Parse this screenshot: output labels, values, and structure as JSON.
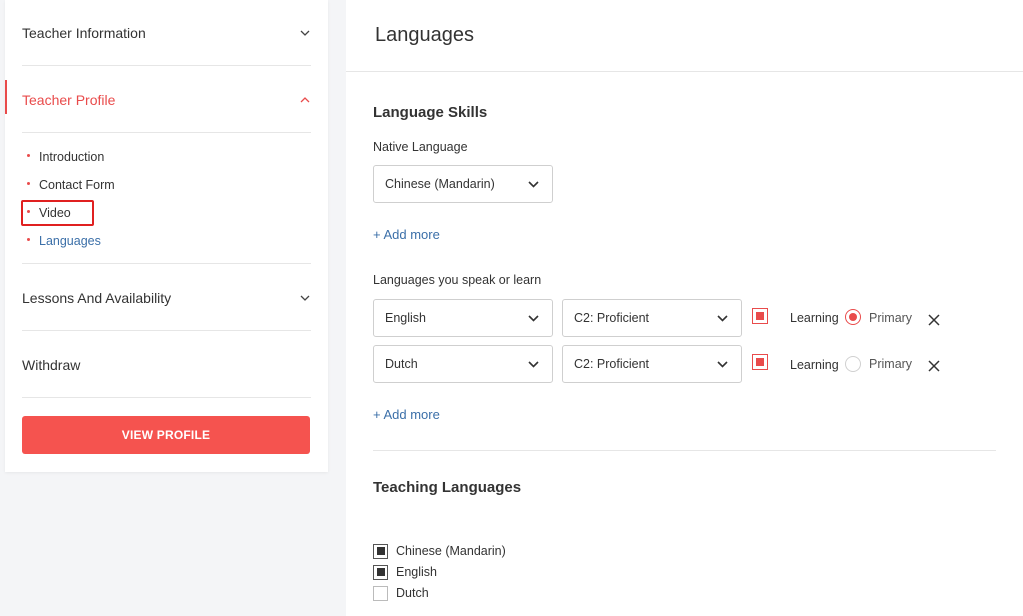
{
  "sidebar": {
    "sections": [
      {
        "label": "Teacher Information",
        "expanded": false
      },
      {
        "label": "Teacher Profile",
        "expanded": true,
        "active": true
      },
      {
        "label": "Lessons And Availability",
        "expanded": false
      },
      {
        "label": "Withdraw"
      }
    ],
    "sub_items": [
      "Introduction",
      "Contact Form",
      "Video",
      "Languages"
    ],
    "current_sub_item": "Languages",
    "view_profile_label": "VIEW PROFILE"
  },
  "main": {
    "title": "Languages",
    "language_skills": {
      "heading": "Language Skills",
      "native_label": "Native Language",
      "native_value": "Chinese (Mandarin)",
      "add_more_native": "+ Add more",
      "speak_label": "Languages you speak or learn",
      "rows": [
        {
          "language": "English",
          "level": "C2: Proficient",
          "learning_label": "Learning",
          "primary_label": "Primary",
          "primary_selected": true
        },
        {
          "language": "Dutch",
          "level": "C2: Proficient",
          "learning_label": "Learning",
          "primary_label": "Primary",
          "primary_selected": false
        }
      ],
      "add_more_speak": "+ Add more"
    },
    "teaching_languages": {
      "heading": "Teaching Languages",
      "items": [
        {
          "label": "Chinese (Mandarin)",
          "checked": true
        },
        {
          "label": "English",
          "checked": true
        },
        {
          "label": "Dutch",
          "checked": false
        }
      ]
    }
  },
  "colors": {
    "accent": "#e94b4b",
    "link": "#3b6fa8",
    "button": "#f5534f"
  }
}
